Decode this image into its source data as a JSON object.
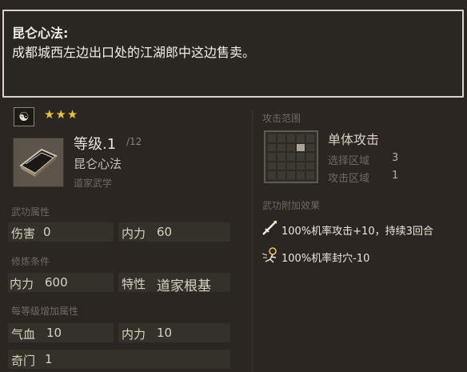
{
  "tooltip": {
    "title": "昆仑心法:",
    "desc": "成都城西左边出口处的江湖郎中这边售卖。"
  },
  "skill": {
    "school_symbol": "☯",
    "stars": "★★★",
    "level": "等级.1",
    "level_max": "/12",
    "name": "昆仑心法",
    "category": "道家武学"
  },
  "sections": {
    "attributes": {
      "title": "武功属性",
      "items": [
        {
          "label": "伤害",
          "value": "0"
        },
        {
          "label": "内力",
          "value": "60"
        }
      ]
    },
    "requirements": {
      "title": "修炼条件",
      "items": [
        {
          "label": "内力",
          "value": "600"
        },
        {
          "label": "特性",
          "value": "道家根基"
        }
      ]
    },
    "per_level": {
      "title": "每等级增加属性",
      "items": [
        {
          "label": "气血",
          "value": "10"
        },
        {
          "label": "内力",
          "value": "10"
        },
        {
          "label": "奇门",
          "value": "1"
        }
      ]
    }
  },
  "attack_range": {
    "title": "攻击范围",
    "type": "单体攻击",
    "select_label": "选择区域",
    "select_value": "3",
    "attack_label": "攻击区域",
    "attack_value": "1"
  },
  "effects": {
    "title": "武功附加效果",
    "items": [
      {
        "icon": "sword-icon",
        "text": "100%机率攻击+10，持续3回合"
      },
      {
        "icon": "acupoint-icon",
        "text": "100%机率封穴-10"
      }
    ]
  },
  "colors": {
    "star": "#e8c23a",
    "panel_bg": "#2b2621",
    "row_bg": "#34302a"
  }
}
